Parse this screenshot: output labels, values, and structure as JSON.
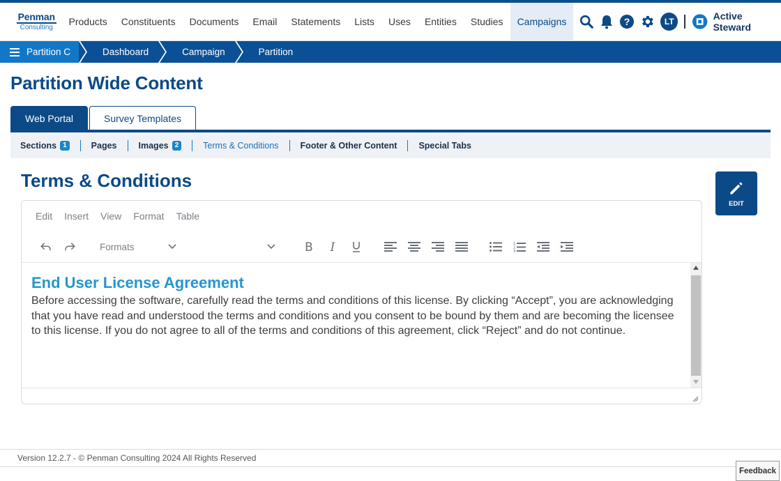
{
  "logo": {
    "line1": "Penman",
    "line2": "Consulting"
  },
  "topnav": {
    "items": [
      "Products",
      "Constituents",
      "Documents",
      "Email",
      "Statements",
      "Lists",
      "Uses",
      "Entities",
      "Studies",
      "Campaigns"
    ],
    "active": "Campaigns"
  },
  "user": {
    "initials": "LT"
  },
  "brand": {
    "name": "Active Steward"
  },
  "breadcrumb": {
    "items": [
      "Partition C",
      "Dashboard",
      "Campaign",
      "Partition"
    ]
  },
  "page": {
    "title": "Partition Wide Content"
  },
  "tabs": {
    "items": [
      "Web Portal",
      "Survey Templates"
    ],
    "active": "Web Portal"
  },
  "subnav": {
    "items": [
      {
        "label": "Sections",
        "badge": "1"
      },
      {
        "label": "Pages"
      },
      {
        "label": "Images",
        "badge": "2"
      },
      {
        "label": "Terms & Conditions",
        "active": true
      },
      {
        "label": "Footer & Other Content"
      },
      {
        "label": "Special Tabs"
      }
    ]
  },
  "section": {
    "title": "Terms & Conditions",
    "edit_label": "EDIT"
  },
  "editor": {
    "menu": [
      "Edit",
      "Insert",
      "View",
      "Format",
      "Table"
    ],
    "formats_label": "Formats",
    "heading": "End User License Agreement",
    "body": "Before accessing the software, carefully read the terms and conditions of this license. By clicking “Accept”, you are acknowledging that you have read and understood the terms and conditions and you consent to be bound by them and are becoming the licensee to this license. If you do not agree to all of the terms and conditions of this agreement, click “Reject” and do not continue."
  },
  "footer": {
    "text": "Version 12.2.7 - © Penman Consulting 2024 All Rights Reserved"
  },
  "feedback": {
    "label": "Feedback"
  },
  "colors": {
    "primary": "#0b4a87",
    "accent": "#1277c7",
    "link": "#2596cf"
  }
}
